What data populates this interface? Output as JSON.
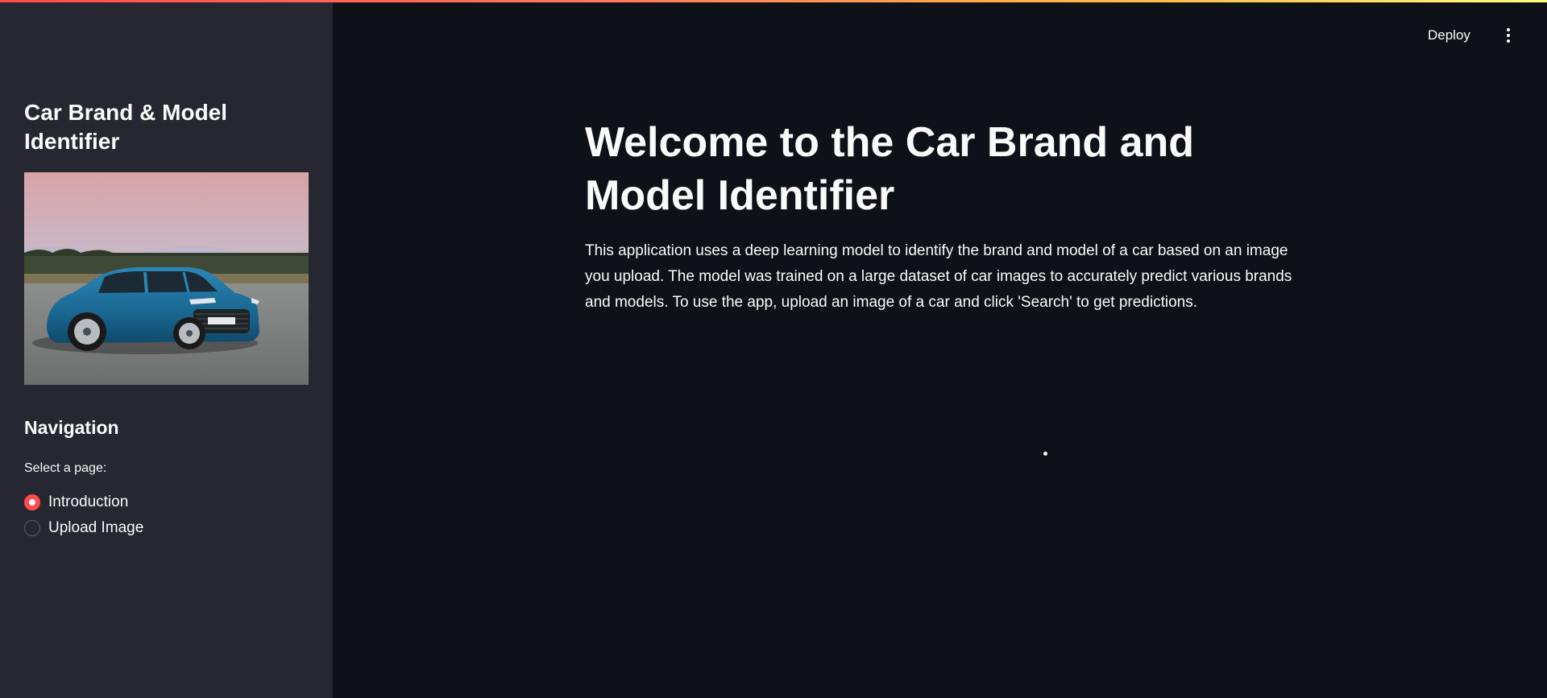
{
  "sidebar": {
    "title": "Car Brand & Model Identifier",
    "image_alt": "car-photo",
    "navigation": {
      "heading": "Navigation",
      "radio_label": "Select a page:",
      "options": [
        {
          "label": "Introduction",
          "selected": true
        },
        {
          "label": "Upload Image",
          "selected": false
        }
      ]
    }
  },
  "header": {
    "deploy_label": "Deploy",
    "menu_icon": "more-vertical-icon"
  },
  "main": {
    "title": "Welcome to the Car Brand and Model Identifier",
    "body": "This application uses a deep learning model to identify the brand and model of a car based on an image you upload. The model was trained on a large dataset of car images to accurately predict various brands and models. To use the app, upload an image of a car and click 'Search' to get predictions."
  },
  "colors": {
    "accent": "#ff4b4b",
    "background": "#0e1117",
    "sidebar_background": "#262730",
    "text": "#fafafa"
  }
}
